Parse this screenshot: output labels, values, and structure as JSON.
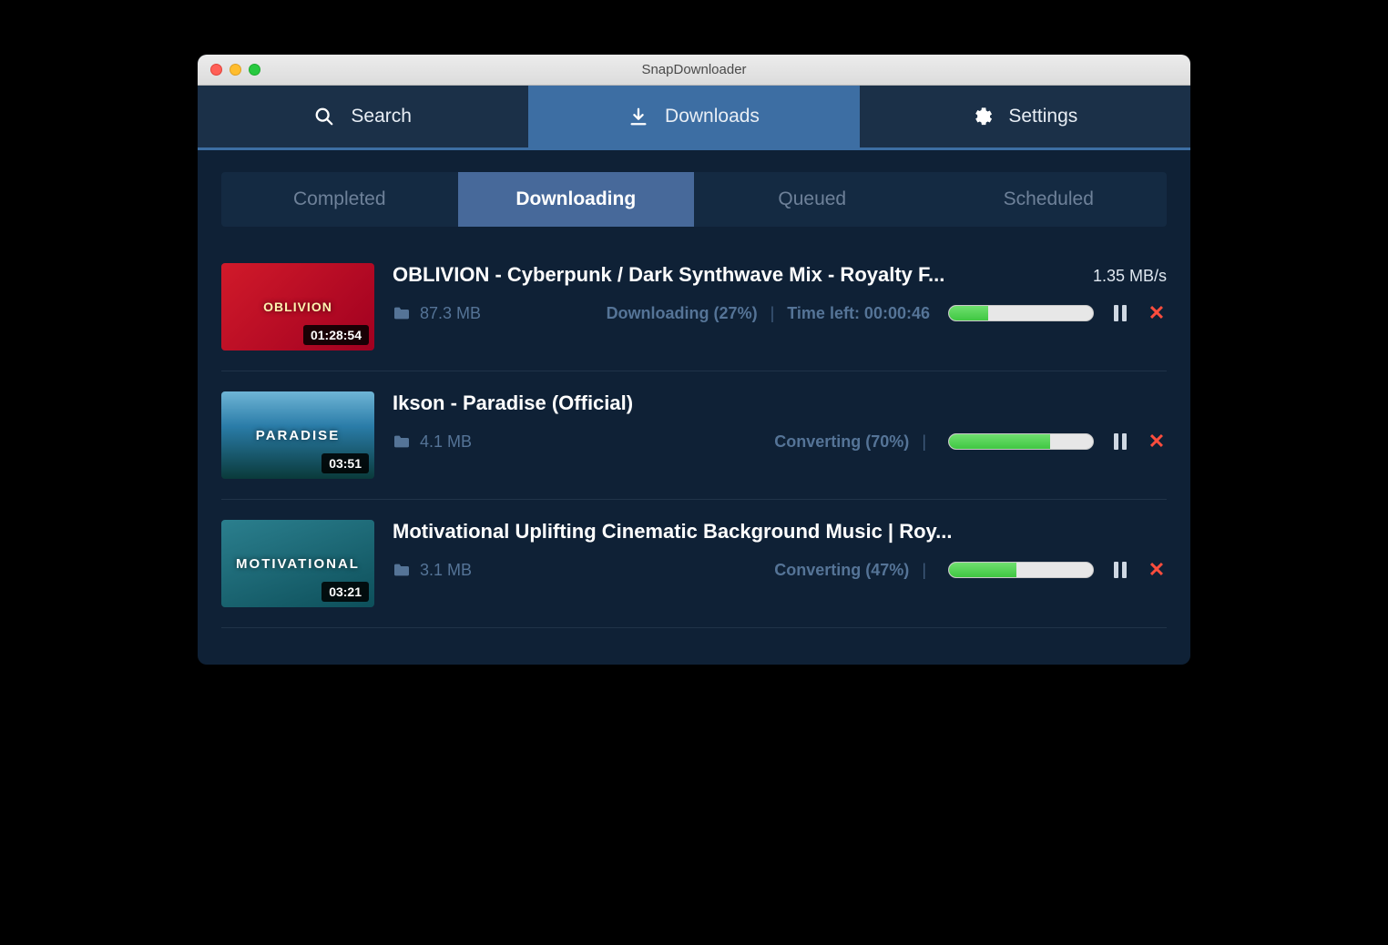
{
  "window": {
    "title": "SnapDownloader"
  },
  "nav": {
    "items": [
      {
        "label": "Search",
        "icon": "search-icon",
        "active": false
      },
      {
        "label": "Downloads",
        "icon": "download-icon",
        "active": true
      },
      {
        "label": "Settings",
        "icon": "gear-icon",
        "active": false
      }
    ]
  },
  "subtabs": [
    {
      "label": "Completed",
      "active": false
    },
    {
      "label": "Downloading",
      "active": true
    },
    {
      "label": "Queued",
      "active": false
    },
    {
      "label": "Scheduled",
      "active": false
    }
  ],
  "items": [
    {
      "title": "OBLIVION - Cyberpunk / Dark Synthwave Mix - Royalty F...",
      "thumb_label": "OBLIVION",
      "thumb_style": "red",
      "duration": "01:28:54",
      "size": "87.3 MB",
      "status": "Downloading (27%)",
      "timeleft": "Time left: 00:00:46",
      "speed": "1.35 MB/s",
      "progress": 27,
      "show_timeleft": true
    },
    {
      "title": "Ikson - Paradise (Official)",
      "thumb_label": "PARADISE",
      "thumb_style": "blue",
      "duration": "03:51",
      "size": "4.1 MB",
      "status": "Converting (70%)",
      "timeleft": "",
      "speed": "",
      "progress": 70,
      "show_timeleft": false
    },
    {
      "title": "Motivational Uplifting Cinematic Background Music | Roy...",
      "thumb_label": "MOTIVATIONAL",
      "thumb_style": "teal",
      "duration": "03:21",
      "size": "3.1 MB",
      "status": "Converting (47%)",
      "timeleft": "",
      "speed": "",
      "progress": 47,
      "show_timeleft": false
    }
  ],
  "sep": "|"
}
